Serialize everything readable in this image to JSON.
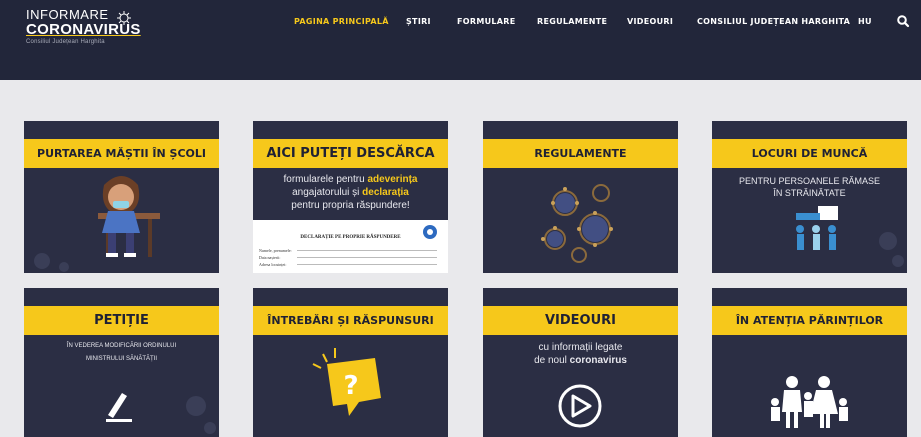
{
  "brand": {
    "line1": "INFORMARE",
    "line2": "CORONAVIRUS",
    "sub": "Consiliul Județean Harghita"
  },
  "nav": {
    "items": [
      {
        "label": "PAGINA PRINCIPALĂ",
        "active": true
      },
      {
        "label": "ȘTIRI",
        "active": false
      },
      {
        "label": "FORMULARE",
        "active": false
      },
      {
        "label": "REGULAMENTE",
        "active": false
      },
      {
        "label": "VIDEOURI",
        "active": false
      },
      {
        "label": "CONSILIUL JUDEȚEAN HARGHITA",
        "active": false
      },
      {
        "label": "HU",
        "active": false
      }
    ],
    "search_icon": "search-icon"
  },
  "colors": {
    "header_bg": "#22263a",
    "tile_bg": "#2b2e44",
    "accent": "#f6c81b",
    "page_bg": "#e9e9ec"
  },
  "tiles": [
    {
      "title": "PURTAREA MĂȘTII ÎN ȘCOLI",
      "icon": "masked-student-illustration"
    },
    {
      "title": "AICI PUTEȚI DESCĂRCA",
      "desc_pre": "formularele pentru ",
      "desc_b1": "adeverința",
      "desc_mid": "angajatorului",
      "desc_and": " și ",
      "desc_b2": "declarația",
      "desc_post": "pentru propria răspundere!",
      "doc_title": "DECLARAȚIE PE PROPRIE RĂSPUNDERE",
      "doc_fields": [
        "Numele, prenumele:",
        "Data nașterii:",
        "Adresa locuinței:"
      ],
      "icon": "document-preview"
    },
    {
      "title": "REGULAMENTE",
      "icon": "virus-cluster-illustration"
    },
    {
      "title": "LOCURI DE MUNCĂ",
      "desc1": "PENTRU PERSOANELE RĂMASE",
      "desc2": "ÎN STRĂINĂTATE",
      "icon": "workers-illustration"
    },
    {
      "title": "PETIȚIE",
      "desc1": "ÎN VEDEREA MODIFICĂRII ORDINULUI",
      "desc2": "MINISTRULUI SĂNĂTĂȚII",
      "icon": "pen-icon"
    },
    {
      "title": "ÎNTREBĂRI ȘI RĂSPUNSURI",
      "icon": "question-bubble-icon"
    },
    {
      "title": "VIDEOURI",
      "desc1": "cu informații legate",
      "desc2_pre": "de noul ",
      "desc2_b": "coronavirus",
      "icon": "play-icon"
    },
    {
      "title": "ÎN ATENȚIA PĂRINȚILOR",
      "icon": "family-icon"
    }
  ]
}
